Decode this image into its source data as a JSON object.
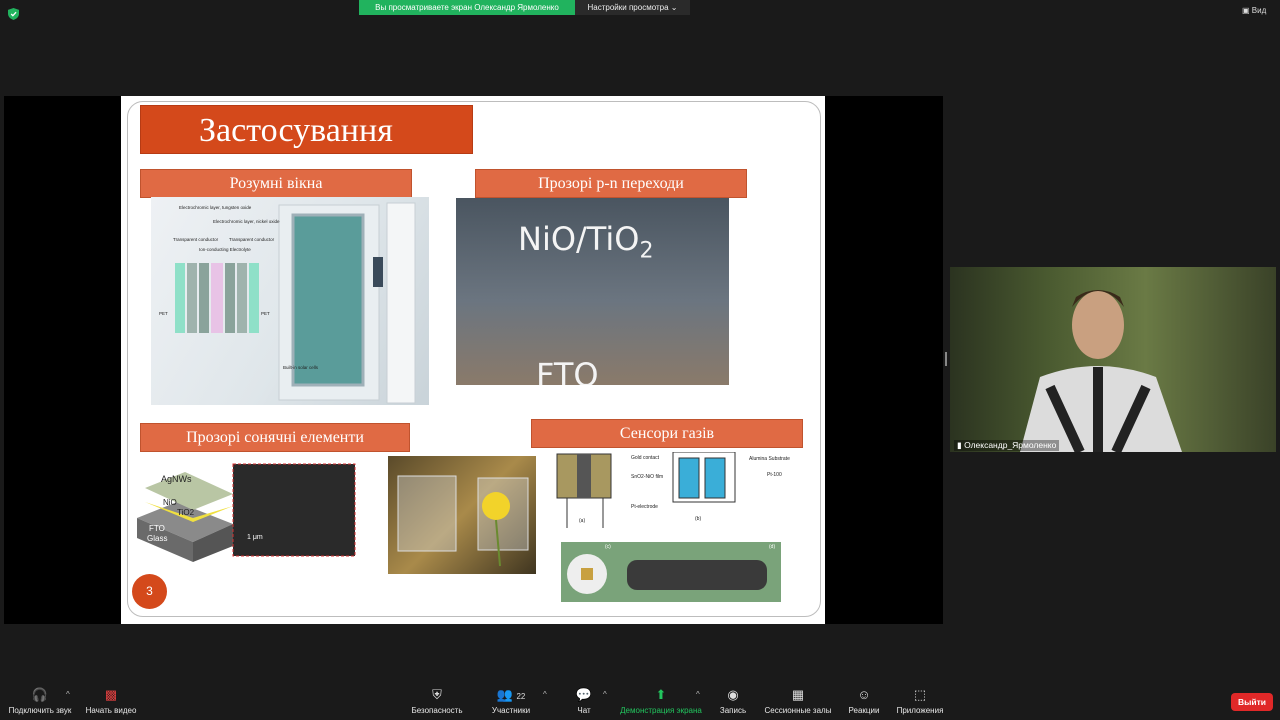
{
  "top_bar": {
    "share_banner": "Вы просматриваете экран Олександр Ярмоленко",
    "view_settings": "Настройки просмотра",
    "view_button": "Вид"
  },
  "slide": {
    "title": "Застосування",
    "sections": {
      "smart_windows": "Розумні вікна",
      "transparent_pn": "Прозорі p-n переходи",
      "transparent_solar": "Прозорі сонячні елементи",
      "gas_sensors": "Сенсори газів"
    },
    "window_diagram": {
      "labels": [
        "Electrochromic layer, tungsten oxide",
        "Electrochromic layer, nickel oxide",
        "Transparent conductor",
        "Transparent conductor",
        "Ion-conducting Electrolyte",
        "PET",
        "PET",
        "Built-in solar cells"
      ]
    },
    "nio_photo": {
      "top_text": "NiO/TiO",
      "subscript": "2",
      "bottom_text": "FTO"
    },
    "solar_layers": [
      "AgNWs",
      "NiO",
      "TiO2",
      "FTO",
      "Glass"
    ],
    "scale_bar": "1 μm",
    "sensor_diagram": {
      "labels": [
        "Gold contact",
        "SnO2-NiO film",
        "Pt-electrode",
        "Alumina Substrate",
        "Pt-100"
      ],
      "panel_a": "(a)",
      "panel_b": "(b)",
      "panel_c": "(c)",
      "panel_d": "(d)"
    },
    "slide_number": "3"
  },
  "video": {
    "participant_name": "Олександр_Ярмоленко"
  },
  "toolbar": {
    "audio": "Подключить звук",
    "video": "Начать видео",
    "security": "Безопасность",
    "participants": "Участники",
    "participants_count": "22",
    "chat": "Чат",
    "share": "Демонстрация экрана",
    "record": "Запись",
    "breakout": "Сессионные залы",
    "reactions": "Реакции",
    "apps": "Приложения",
    "leave": "Выйти"
  },
  "colors": {
    "accent_green": "#21b35e",
    "slide_orange": "#d4491b",
    "leave_red": "#e02828"
  }
}
